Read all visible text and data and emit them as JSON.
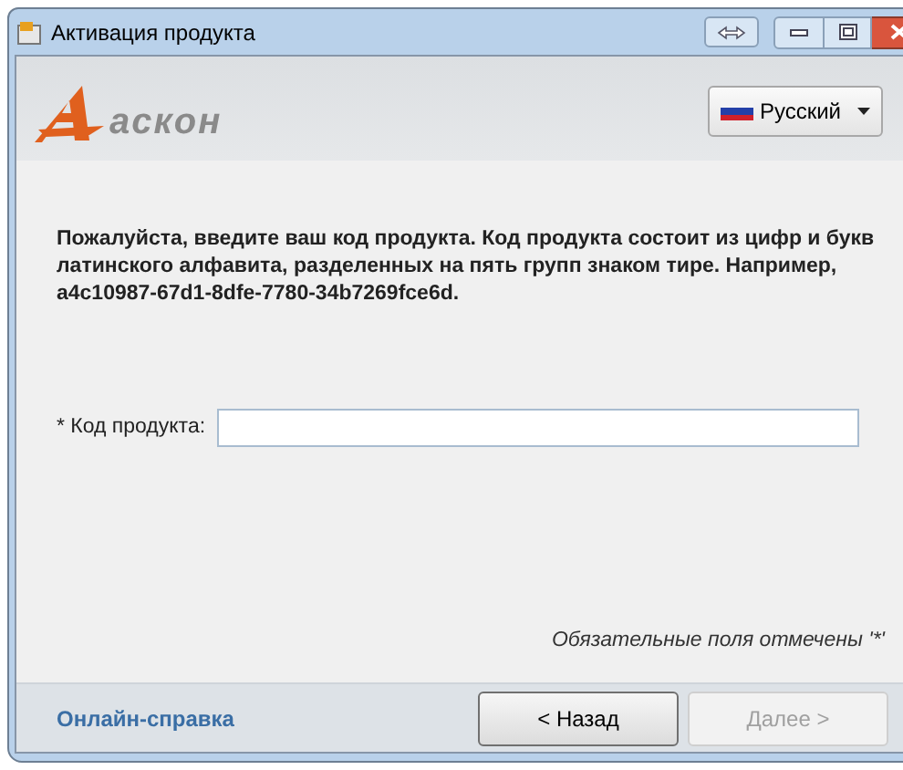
{
  "window": {
    "title": "Активация продукта"
  },
  "logo": {
    "text": "аскон"
  },
  "language": {
    "label": "Русский"
  },
  "instructions": "Пожалуйста, введите ваш код продукта. Код продукта состоит из цифр и букв латинского алфавита, разделенных на пять групп знаком тире. Например, a4c10987-67d1-8dfe-7780-34b7269fce6d.",
  "field": {
    "label": "* Код продукта:"
  },
  "required_note": "Обязательные поля отмечены '*'",
  "help_link": "Онлайн-справка",
  "buttons": [
    {
      "label": "< Назад",
      "disabled": false
    },
    {
      "label": "Далее >",
      "disabled": true
    }
  ]
}
